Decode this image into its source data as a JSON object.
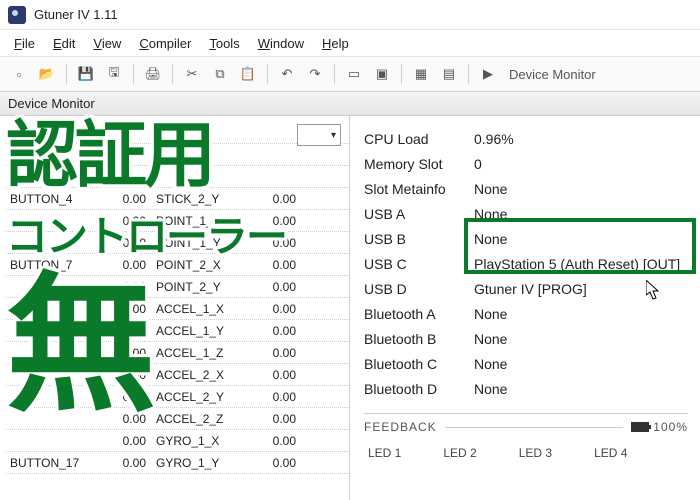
{
  "window": {
    "title": "Gtuner IV 1.11"
  },
  "menubar": [
    {
      "letter": "F",
      "rest": "ile"
    },
    {
      "letter": "E",
      "rest": "dit"
    },
    {
      "letter": "V",
      "rest": "iew"
    },
    {
      "letter": "C",
      "rest": "ompiler"
    },
    {
      "letter": "T",
      "rest": "ools"
    },
    {
      "letter": "W",
      "rest": "indow"
    },
    {
      "letter": "H",
      "rest": "elp"
    }
  ],
  "toolbar": {
    "rightLabel": "Device Monitor"
  },
  "panelTitle": "Device Monitor",
  "leftGrid": [
    {
      "a": "",
      "av": "",
      "b": "",
      "bv": ""
    },
    {
      "a": "",
      "av": "",
      "b": "",
      "bv": ""
    },
    {
      "a": "",
      "av": "",
      "b": "",
      "bv": ""
    },
    {
      "a": "BUTTON_4",
      "av": "0.00",
      "b": "STICK_2_Y",
      "bv": "0.00"
    },
    {
      "a": "",
      "av": "0.00",
      "b": "POINT_1_X",
      "bv": "0.00"
    },
    {
      "a": "",
      "av": "0.00",
      "b": "POINT_1_Y",
      "bv": "0.00"
    },
    {
      "a": "BUTTON_7",
      "av": "0.00",
      "b": "POINT_2_X",
      "bv": "0.00"
    },
    {
      "a": "",
      "av": "0.00",
      "b": "POINT_2_Y",
      "bv": "0.00"
    },
    {
      "a": "",
      "av": "0.00",
      "b": "ACCEL_1_X",
      "bv": "0.00"
    },
    {
      "a": "",
      "av": "0.00",
      "b": "ACCEL_1_Y",
      "bv": "0.00"
    },
    {
      "a": "",
      "av": "0.00",
      "b": "ACCEL_1_Z",
      "bv": "0.00"
    },
    {
      "a": "",
      "av": "0.00",
      "b": "ACCEL_2_X",
      "bv": "0.00"
    },
    {
      "a": "",
      "av": "0.00",
      "b": "ACCEL_2_Y",
      "bv": "0.00"
    },
    {
      "a": "",
      "av": "0.00",
      "b": "ACCEL_2_Z",
      "bv": "0.00"
    },
    {
      "a": "",
      "av": "0.00",
      "b": "GYRO_1_X",
      "bv": "0.00"
    },
    {
      "a": "BUTTON_17",
      "av": "0.00",
      "b": "GYRO_1_Y",
      "bv": "0.00"
    }
  ],
  "status": {
    "cpuLoad": {
      "k": "CPU Load",
      "v": "0.96%"
    },
    "memorySlot": {
      "k": "Memory Slot",
      "v": "0"
    },
    "slotMeta": {
      "k": "Slot Metainfo",
      "v": "None"
    },
    "usbA": {
      "k": "USB A",
      "v": "None"
    },
    "usbB": {
      "k": "USB B",
      "v": "None"
    },
    "usbC": {
      "k": "USB C",
      "v": "PlayStation 5 (Auth Reset) [OUT]"
    },
    "usbD": {
      "k": "USB D",
      "v": "Gtuner IV [PROG]"
    },
    "btA": {
      "k": "Bluetooth A",
      "v": "None"
    },
    "btB": {
      "k": "Bluetooth B",
      "v": "None"
    },
    "btC": {
      "k": "Bluetooth C",
      "v": "None"
    },
    "btD": {
      "k": "Bluetooth D",
      "v": "None"
    }
  },
  "feedback": {
    "label": "FEEDBACK",
    "batteryPct": "100%",
    "leds": [
      "LED 1",
      "LED 2",
      "LED 3",
      "LED 4"
    ]
  },
  "overlay": {
    "line1": "認証用",
    "line2": "コントローラー",
    "line3": "無"
  },
  "highlightColor": "#0a7a2a"
}
